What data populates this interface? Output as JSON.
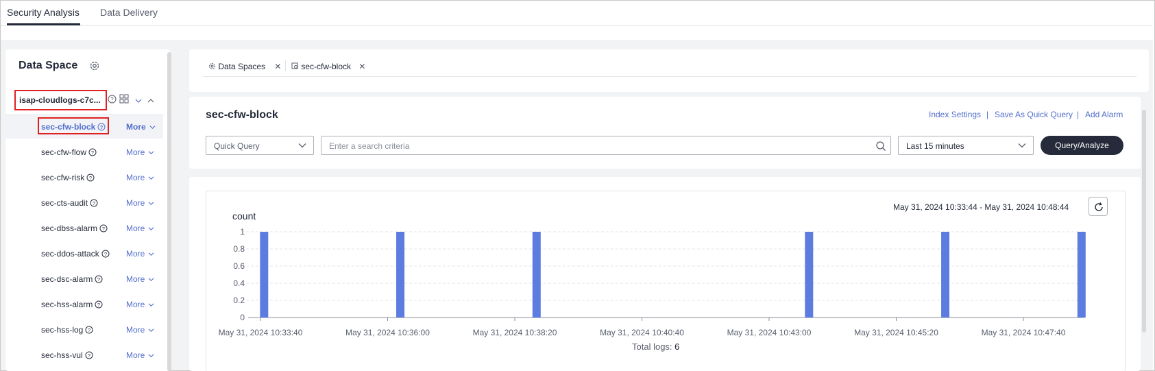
{
  "top_tabs": [
    {
      "label": "Security Analysis",
      "active": true
    },
    {
      "label": "Data Delivery",
      "active": false
    }
  ],
  "sidebar": {
    "title": "Data Space",
    "gear_icon": "gear-icon",
    "workspace": "isap-cloudlogs-c7c...",
    "more_label": "More",
    "streams": [
      {
        "label": "sec-cfw-block",
        "selected": true
      },
      {
        "label": "sec-cfw-flow",
        "selected": false
      },
      {
        "label": "sec-cfw-risk",
        "selected": false
      },
      {
        "label": "sec-cts-audit",
        "selected": false
      },
      {
        "label": "sec-dbss-alarm",
        "selected": false
      },
      {
        "label": "sec-ddos-attack",
        "selected": false
      },
      {
        "label": "sec-dsc-alarm",
        "selected": false
      },
      {
        "label": "sec-hss-alarm",
        "selected": false
      },
      {
        "label": "sec-hss-log",
        "selected": false
      },
      {
        "label": "sec-hss-vul",
        "selected": false
      }
    ]
  },
  "main_tabs": [
    {
      "label": "Data Spaces",
      "icon": "gear-icon"
    },
    {
      "label": "sec-cfw-block",
      "icon": "stream-search-icon"
    }
  ],
  "query": {
    "title": "sec-cfw-block",
    "links": [
      "Index Settings",
      "Save As Quick Query",
      "Add Alarm"
    ],
    "quick_query_placeholder": "Quick Query",
    "search_placeholder": "Enter a search criteria",
    "time_selected": "Last 15 minutes",
    "submit_label": "Query/Analyze"
  },
  "chart": {
    "time_range": "May 31, 2024 10:33:44 - May 31, 2024 10:48:44",
    "total_label": "Total logs:",
    "total_value": "6"
  },
  "colors": {
    "accent": "#526ecc",
    "bar": "#5d7ce0",
    "dark": "#252b3a",
    "highlight_box": "#e02020"
  },
  "chart_data": {
    "type": "bar",
    "ylabel": "count",
    "ylim": [
      0,
      1
    ],
    "yticks": [
      "0",
      "0.2",
      "0.4",
      "0.6",
      "0.8",
      "1"
    ],
    "xticks": [
      "May 31, 2024 10:33:40",
      "May 31, 2024 10:36:00",
      "May 31, 2024 10:38:20",
      "May 31, 2024 10:40:40",
      "May 31, 2024 10:43:00",
      "May 31, 2024 10:45:20",
      "May 31, 2024 10:47:40"
    ],
    "series": [
      {
        "x": [
          "10:33:44",
          "10:36:14",
          "10:38:44",
          "10:43:44",
          "10:46:14",
          "10:48:44"
        ],
        "values": [
          1,
          1,
          1,
          1,
          1,
          1
        ]
      }
    ]
  }
}
